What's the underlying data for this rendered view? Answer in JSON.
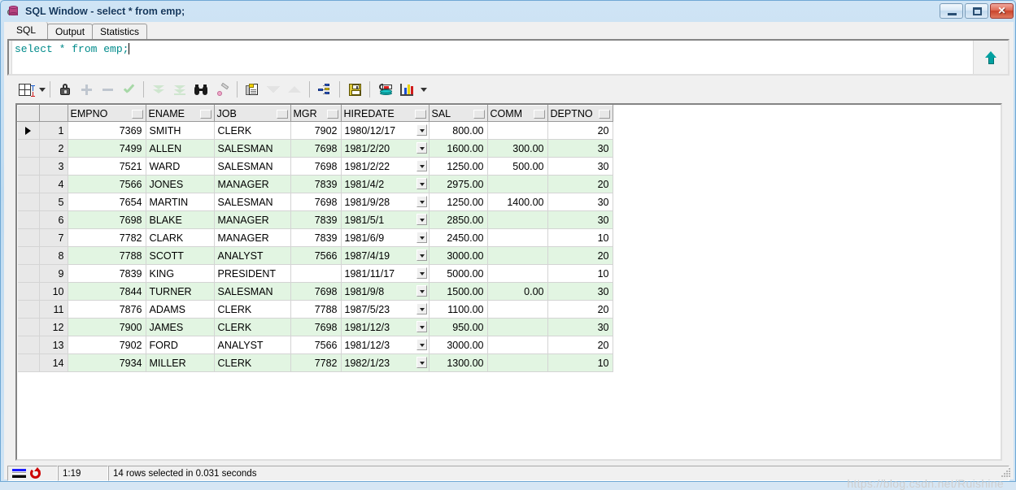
{
  "window": {
    "title": "SQL Window - select * from emp;",
    "icon": "database-icon",
    "buttons": {
      "minimize": "–",
      "maximize": "□",
      "close": "✕"
    }
  },
  "tabs": [
    {
      "label": "SQL",
      "active": true
    },
    {
      "label": "Output",
      "active": false
    },
    {
      "label": "Statistics",
      "active": false
    }
  ],
  "editor": {
    "sql": "select * from emp;",
    "expand_icon": "up-arrow-icon"
  },
  "toolbar": {
    "items": [
      {
        "name": "grid-view-button",
        "icon": "grid-icon",
        "dropdown": true
      },
      {
        "name": "lock-record-button",
        "icon": "lock-icon"
      },
      {
        "name": "insert-record-button",
        "icon": "plus-icon"
      },
      {
        "name": "delete-record-button",
        "icon": "minus-icon"
      },
      {
        "name": "post-changes-button",
        "icon": "check-icon"
      },
      {
        "name": "fetch-next-page-button",
        "icon": "double-chevron-down-icon"
      },
      {
        "name": "fetch-last-page-button",
        "icon": "chevron-down-to-bar-icon"
      },
      {
        "name": "find-button",
        "icon": "binoculars-icon"
      },
      {
        "name": "clear-button",
        "icon": "eraser-pencil-icon"
      },
      {
        "name": "copy-to-clipboard-button",
        "icon": "copy-sheet-icon"
      },
      {
        "name": "sort-descending-button",
        "icon": "triangle-down-icon"
      },
      {
        "name": "sort-ascending-button",
        "icon": "triangle-up-icon"
      },
      {
        "name": "explain-plan-button",
        "icon": "explain-plan-icon"
      },
      {
        "name": "save-button",
        "icon": "diskette-icon"
      },
      {
        "name": "commit-button",
        "icon": "database-commit-icon"
      },
      {
        "name": "chart-button",
        "icon": "bar-chart-icon",
        "dropdown": true
      }
    ]
  },
  "grid": {
    "columns": [
      "EMPNO",
      "ENAME",
      "JOB",
      "MGR",
      "HIREDATE",
      "SAL",
      "COMM",
      "DEPTNO"
    ],
    "selected_row": 1,
    "rows": [
      {
        "n": "1",
        "EMPNO": "7369",
        "ENAME": "SMITH",
        "JOB": "CLERK",
        "MGR": "7902",
        "HIREDATE": "1980/12/17",
        "SAL": "800.00",
        "COMM": "",
        "DEPTNO": "20"
      },
      {
        "n": "2",
        "EMPNO": "7499",
        "ENAME": "ALLEN",
        "JOB": "SALESMAN",
        "MGR": "7698",
        "HIREDATE": "1981/2/20",
        "SAL": "1600.00",
        "COMM": "300.00",
        "DEPTNO": "30"
      },
      {
        "n": "3",
        "EMPNO": "7521",
        "ENAME": "WARD",
        "JOB": "SALESMAN",
        "MGR": "7698",
        "HIREDATE": "1981/2/22",
        "SAL": "1250.00",
        "COMM": "500.00",
        "DEPTNO": "30"
      },
      {
        "n": "4",
        "EMPNO": "7566",
        "ENAME": "JONES",
        "JOB": "MANAGER",
        "MGR": "7839",
        "HIREDATE": "1981/4/2",
        "SAL": "2975.00",
        "COMM": "",
        "DEPTNO": "20"
      },
      {
        "n": "5",
        "EMPNO": "7654",
        "ENAME": "MARTIN",
        "JOB": "SALESMAN",
        "MGR": "7698",
        "HIREDATE": "1981/9/28",
        "SAL": "1250.00",
        "COMM": "1400.00",
        "DEPTNO": "30"
      },
      {
        "n": "6",
        "EMPNO": "7698",
        "ENAME": "BLAKE",
        "JOB": "MANAGER",
        "MGR": "7839",
        "HIREDATE": "1981/5/1",
        "SAL": "2850.00",
        "COMM": "",
        "DEPTNO": "30"
      },
      {
        "n": "7",
        "EMPNO": "7782",
        "ENAME": "CLARK",
        "JOB": "MANAGER",
        "MGR": "7839",
        "HIREDATE": "1981/6/9",
        "SAL": "2450.00",
        "COMM": "",
        "DEPTNO": "10"
      },
      {
        "n": "8",
        "EMPNO": "7788",
        "ENAME": "SCOTT",
        "JOB": "ANALYST",
        "MGR": "7566",
        "HIREDATE": "1987/4/19",
        "SAL": "3000.00",
        "COMM": "",
        "DEPTNO": "20"
      },
      {
        "n": "9",
        "EMPNO": "7839",
        "ENAME": "KING",
        "JOB": "PRESIDENT",
        "MGR": "",
        "HIREDATE": "1981/11/17",
        "SAL": "5000.00",
        "COMM": "",
        "DEPTNO": "10"
      },
      {
        "n": "10",
        "EMPNO": "7844",
        "ENAME": "TURNER",
        "JOB": "SALESMAN",
        "MGR": "7698",
        "HIREDATE": "1981/9/8",
        "SAL": "1500.00",
        "COMM": "0.00",
        "DEPTNO": "30"
      },
      {
        "n": "11",
        "EMPNO": "7876",
        "ENAME": "ADAMS",
        "JOB": "CLERK",
        "MGR": "7788",
        "HIREDATE": "1987/5/23",
        "SAL": "1100.00",
        "COMM": "",
        "DEPTNO": "20"
      },
      {
        "n": "12",
        "EMPNO": "7900",
        "ENAME": "JAMES",
        "JOB": "CLERK",
        "MGR": "7698",
        "HIREDATE": "1981/12/3",
        "SAL": "950.00",
        "COMM": "",
        "DEPTNO": "30"
      },
      {
        "n": "13",
        "EMPNO": "7902",
        "ENAME": "FORD",
        "JOB": "ANALYST",
        "MGR": "7566",
        "HIREDATE": "1981/12/3",
        "SAL": "3000.00",
        "COMM": "",
        "DEPTNO": "20"
      },
      {
        "n": "14",
        "EMPNO": "7934",
        "ENAME": "MILLER",
        "JOB": "CLERK",
        "MGR": "7782",
        "HIREDATE": "1982/1/23",
        "SAL": "1300.00",
        "COMM": "",
        "DEPTNO": "10"
      }
    ]
  },
  "statusbar": {
    "cursor_position": "1:19",
    "message": "14 rows selected in 0.031 seconds"
  },
  "watermark": "https://blog.csdn.net/Ruishine",
  "colors": {
    "sql_text": "#008b8b",
    "row_alt": "#e2f5e2",
    "null_cell": "#fdf8dc",
    "title_text": "#12365c"
  }
}
